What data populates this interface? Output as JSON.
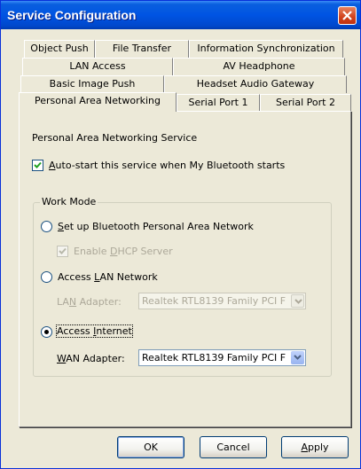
{
  "window": {
    "title": "Service Configuration"
  },
  "tabs": [
    {
      "label": "Object Push",
      "active": false
    },
    {
      "label": "File Transfer",
      "active": false
    },
    {
      "label": "Information Synchronization",
      "active": false
    },
    {
      "label": "LAN Access",
      "active": false
    },
    {
      "label": "AV Headphone",
      "active": false
    },
    {
      "label": "Basic Image Push",
      "active": false
    },
    {
      "label": "Headset Audio Gateway",
      "active": false
    },
    {
      "label": "Personal Area Networking",
      "active": true
    },
    {
      "label": "Serial Port 1",
      "active": false
    },
    {
      "label": "Serial Port 2",
      "active": false
    }
  ],
  "service": {
    "heading": "Personal Area Networking Service",
    "autostart": {
      "label_mnemonic": "A",
      "label_rest": "uto-start this service when My Bluetooth starts",
      "checked": true
    }
  },
  "work_mode": {
    "title": "Work Mode",
    "option1": {
      "label_mnemonic": "S",
      "label_rest": "et up Bluetooth Personal Area Network",
      "selected": false
    },
    "dhcp": {
      "label_pre": "Enable ",
      "label_mnemonic": "D",
      "label_rest": "HCP Server",
      "checked": true,
      "enabled": false
    },
    "option2": {
      "label_pre": "Access ",
      "label_mnemonic": "L",
      "label_rest": "AN Network",
      "selected": false
    },
    "lan_adapter": {
      "label_pre": "LA",
      "label_mnemonic": "N",
      "label_rest": " Adapter:",
      "value": "Realtek RTL8139 Family PCI F",
      "enabled": false
    },
    "option3": {
      "label_pre": "Access ",
      "label_mnemonic": "I",
      "label_rest": "nternet",
      "selected": true
    },
    "wan_adapter": {
      "label_mnemonic": "W",
      "label_rest": "AN Adapter:",
      "value": "Realtek RTL8139 Family PCI F",
      "enabled": true
    }
  },
  "buttons": {
    "ok": "OK",
    "cancel": "Cancel",
    "apply_mnemonic": "A",
    "apply_rest": "pply"
  },
  "icons": {
    "close": "close-x-icon",
    "check": "checkmark-icon",
    "dropdown": "dropdown-arrow-icon"
  },
  "colors": {
    "titlebar": "#0054e3",
    "face": "#ece9d8",
    "close_button": "#d1421d"
  }
}
